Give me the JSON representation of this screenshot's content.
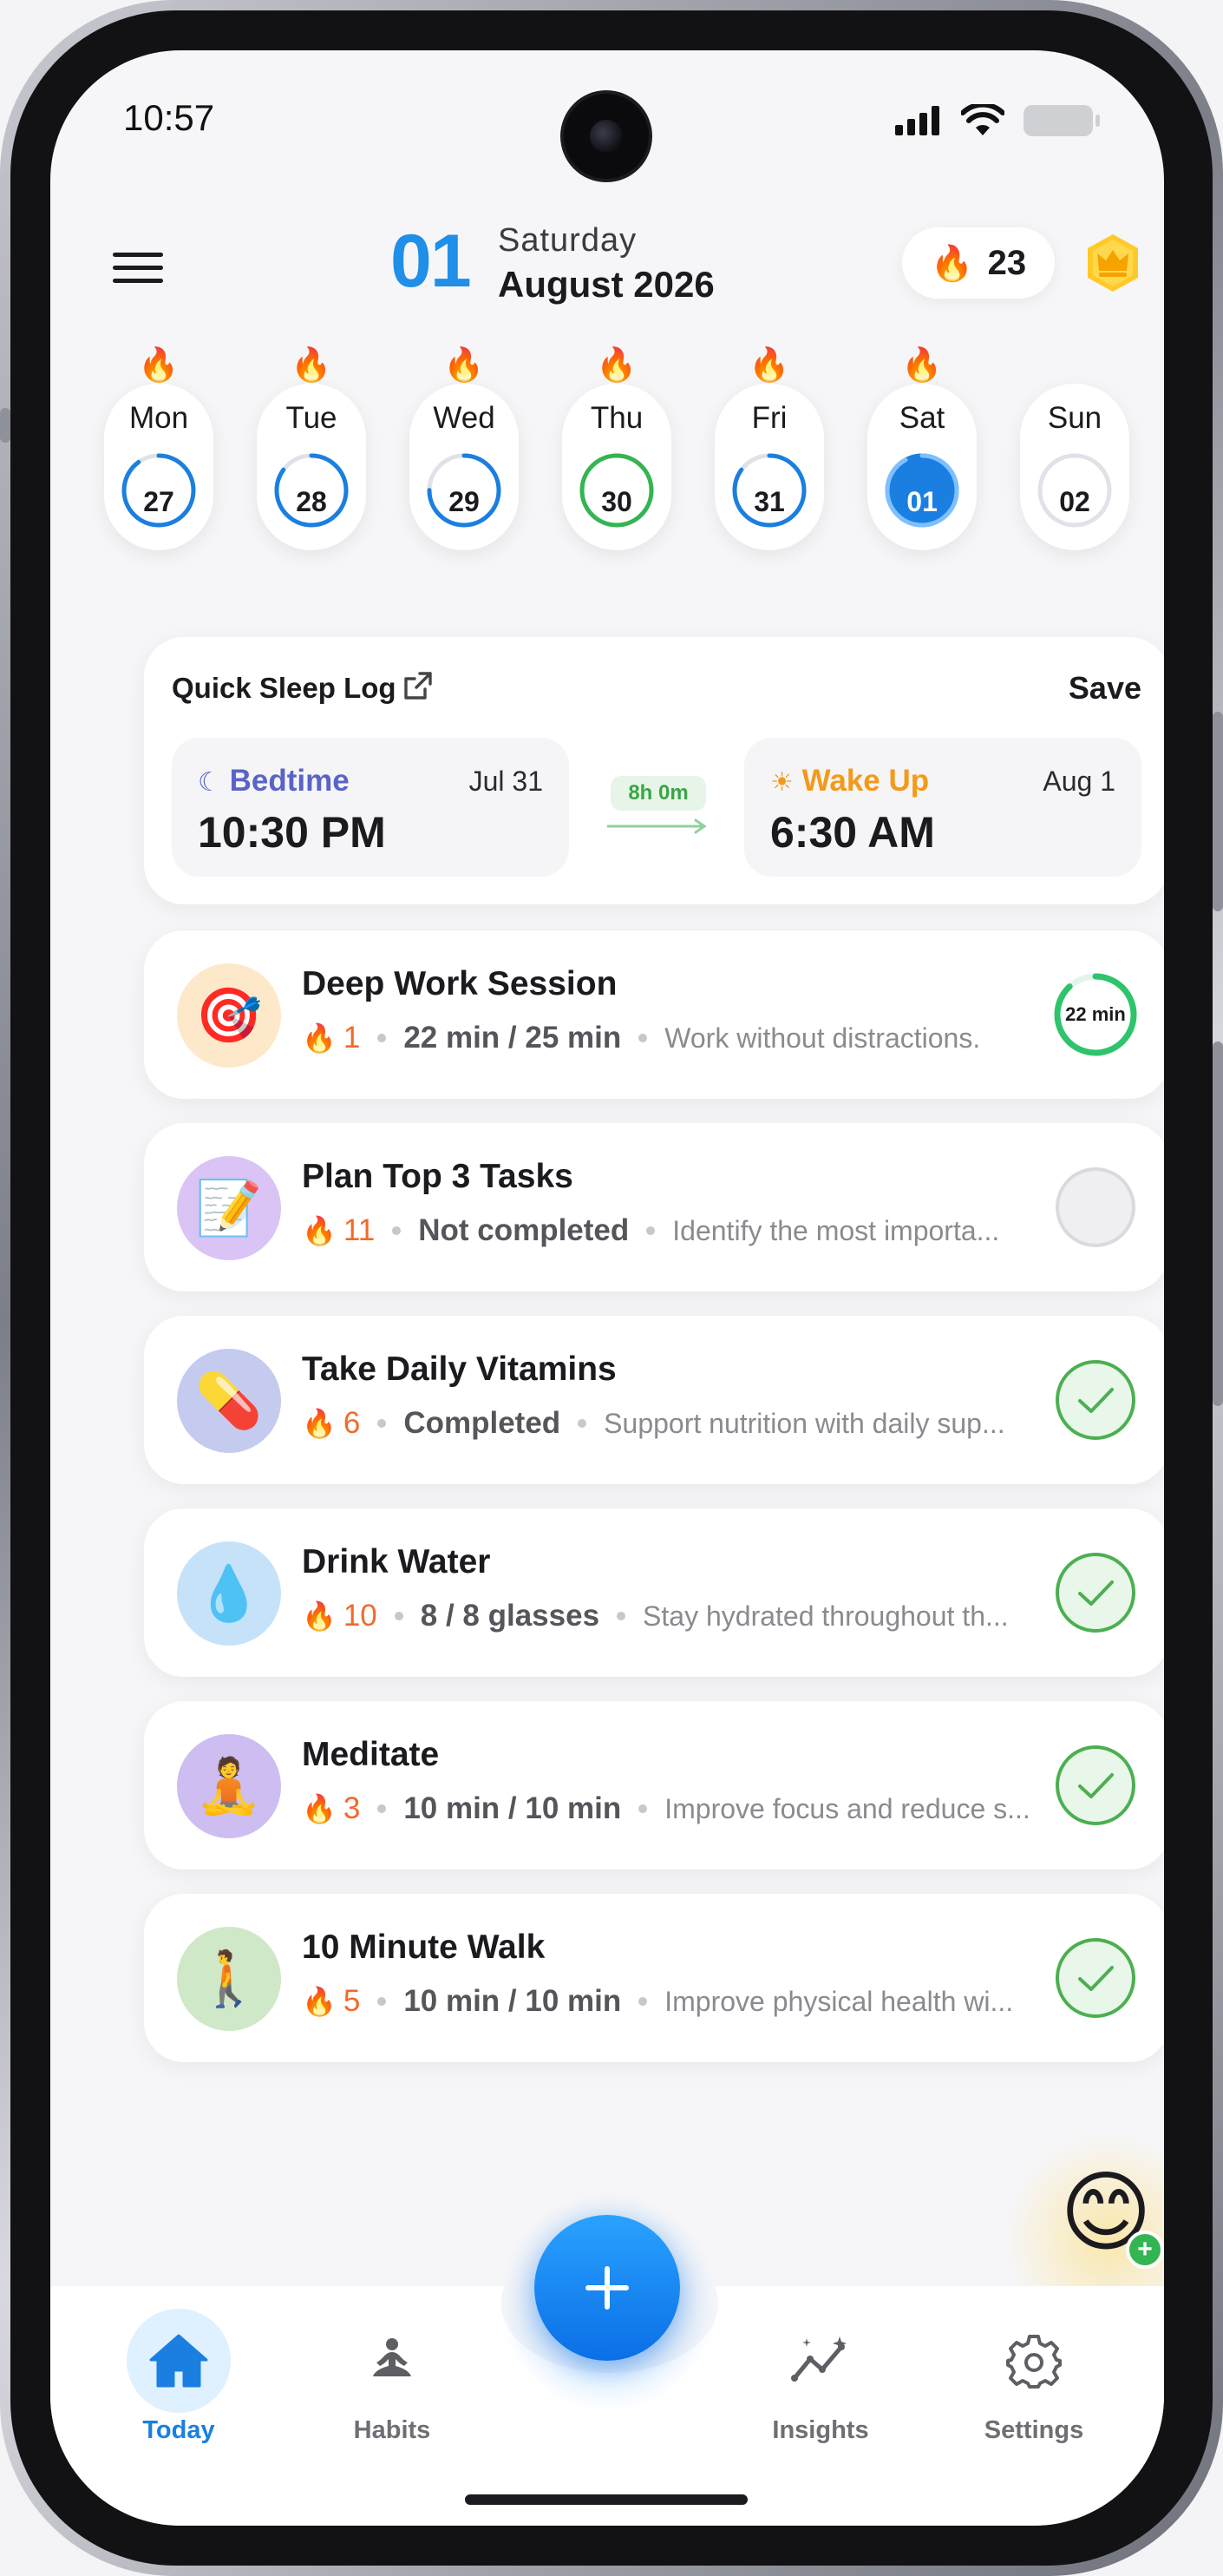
{
  "status_bar": {
    "time": "10:57"
  },
  "header": {
    "date_number": "01",
    "weekday": "Saturday",
    "month_year": "August 2026",
    "streak_count": "23"
  },
  "week": [
    {
      "label": "Mon",
      "date": "27",
      "flame": true,
      "progress": 0.9,
      "color": "#1a7fe0",
      "selected": false
    },
    {
      "label": "Tue",
      "date": "28",
      "flame": true,
      "progress": 0.85,
      "color": "#1a7fe0",
      "selected": false
    },
    {
      "label": "Wed",
      "date": "29",
      "flame": true,
      "progress": 0.75,
      "color": "#1a7fe0",
      "selected": false
    },
    {
      "label": "Thu",
      "date": "30",
      "flame": true,
      "progress": 1.0,
      "color": "#34b551",
      "selected": false
    },
    {
      "label": "Fri",
      "date": "31",
      "flame": true,
      "progress": 0.85,
      "color": "#1a7fe0",
      "selected": false
    },
    {
      "label": "Sat",
      "date": "01",
      "flame": true,
      "progress": 0.92,
      "color": "#1a7fe0",
      "selected": true
    },
    {
      "label": "Sun",
      "date": "02",
      "flame": false,
      "progress": 0,
      "color": "#e0e0e4",
      "selected": false
    }
  ],
  "sleep_log": {
    "title": "Quick Sleep Log",
    "save_label": "Save",
    "bedtime": {
      "label": "Bedtime",
      "date": "Jul 31",
      "time": "10:30 PM",
      "color": "#5a63c7"
    },
    "wakeup": {
      "label": "Wake Up",
      "date": "Aug 1",
      "time": "6:30 AM",
      "color": "#f39a1a"
    },
    "duration": "8h 0m"
  },
  "habits": [
    {
      "name": "Deep Work Session",
      "icon": "target-icon",
      "emoji": "🎯",
      "bg": "#fde9c9",
      "streak": "1",
      "progress": "22 min / 25 min",
      "description": "Work without distractions.",
      "state": "ring",
      "ring_label": "22 min",
      "ring_fraction": 0.88
    },
    {
      "name": "Plan Top 3 Tasks",
      "icon": "memo-icon",
      "emoji": "📝",
      "bg": "#d9c4f5",
      "streak": "11",
      "progress": "Not completed",
      "description": "Identify the most importa...",
      "state": "empty"
    },
    {
      "name": "Take Daily Vitamins",
      "icon": "pill-icon",
      "emoji": "💊",
      "bg": "#c4cbef",
      "streak": "6",
      "progress": "Completed",
      "description": "Support nutrition with daily sup...",
      "state": "done"
    },
    {
      "name": "Drink Water",
      "icon": "droplet-icon",
      "emoji": "💧",
      "bg": "#c6e2f8",
      "streak": "10",
      "progress": "8 / 8 glasses",
      "description": "Stay hydrated throughout th...",
      "state": "done"
    },
    {
      "name": "Meditate",
      "icon": "meditation-icon",
      "emoji": "🧘",
      "bg": "#cdbdf0",
      "streak": "3",
      "progress": "10 min / 10 min",
      "description": "Improve focus and reduce s...",
      "state": "done"
    },
    {
      "name": "10 Minute Walk",
      "icon": "walking-icon",
      "emoji": "🚶",
      "bg": "#cfe8c7",
      "streak": "5",
      "progress": "10 min / 10 min",
      "description": "Improve physical health wi...",
      "state": "done"
    }
  ],
  "nav": {
    "today": "Today",
    "habits": "Habits",
    "insights": "Insights",
    "settings": "Settings"
  }
}
